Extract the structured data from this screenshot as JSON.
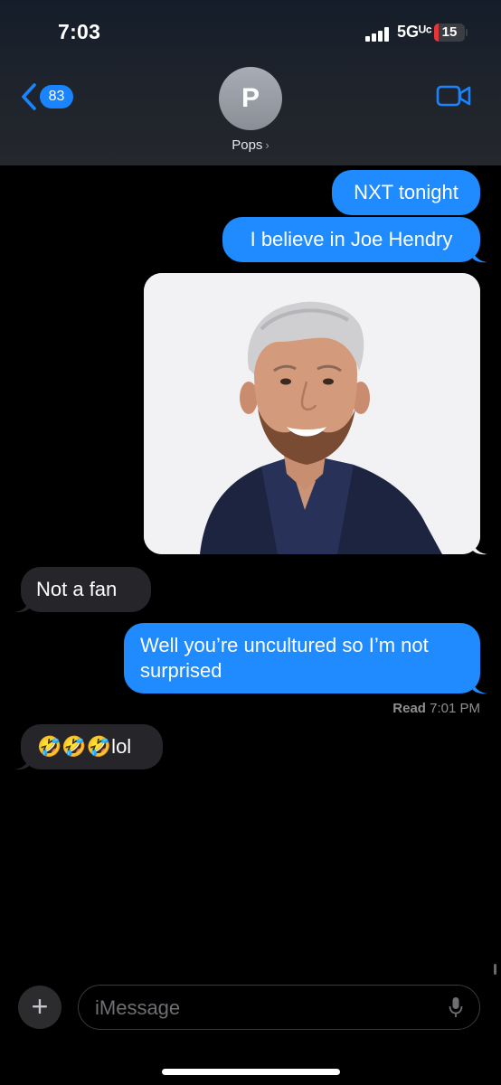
{
  "status_bar": {
    "time": "7:03",
    "network": "5Gᵁᶜ",
    "battery": "15",
    "battery_level": 0.15
  },
  "header": {
    "back_count": "83",
    "avatar_initial": "P",
    "contact_name": "Pops",
    "contact_chevron": "›"
  },
  "colors": {
    "sent_bubble": "#1f8bff",
    "received_bubble": "#26252a",
    "accent": "#1a84ff",
    "battery_low": "#e5373a"
  },
  "icons": {
    "back": "chevron-left-icon",
    "video": "video-camera-icon",
    "plus": "plus-icon",
    "mic": "microphone-icon"
  },
  "messages": [
    {
      "from": "me",
      "text": "NXT tonight"
    },
    {
      "from": "me",
      "text": "I believe in Joe Hendry"
    },
    {
      "from": "me",
      "type": "photo"
    },
    {
      "from": "them",
      "text": "Not a fan"
    },
    {
      "from": "me",
      "text": "Well you’re uncultured so I’m not surprised"
    },
    {
      "from": "them",
      "text": "🤣🤣🤣lol"
    }
  ],
  "receipt": {
    "status": "Read",
    "time": "7:01 PM"
  },
  "composer": {
    "plus": "+",
    "placeholder": "iMessage"
  }
}
